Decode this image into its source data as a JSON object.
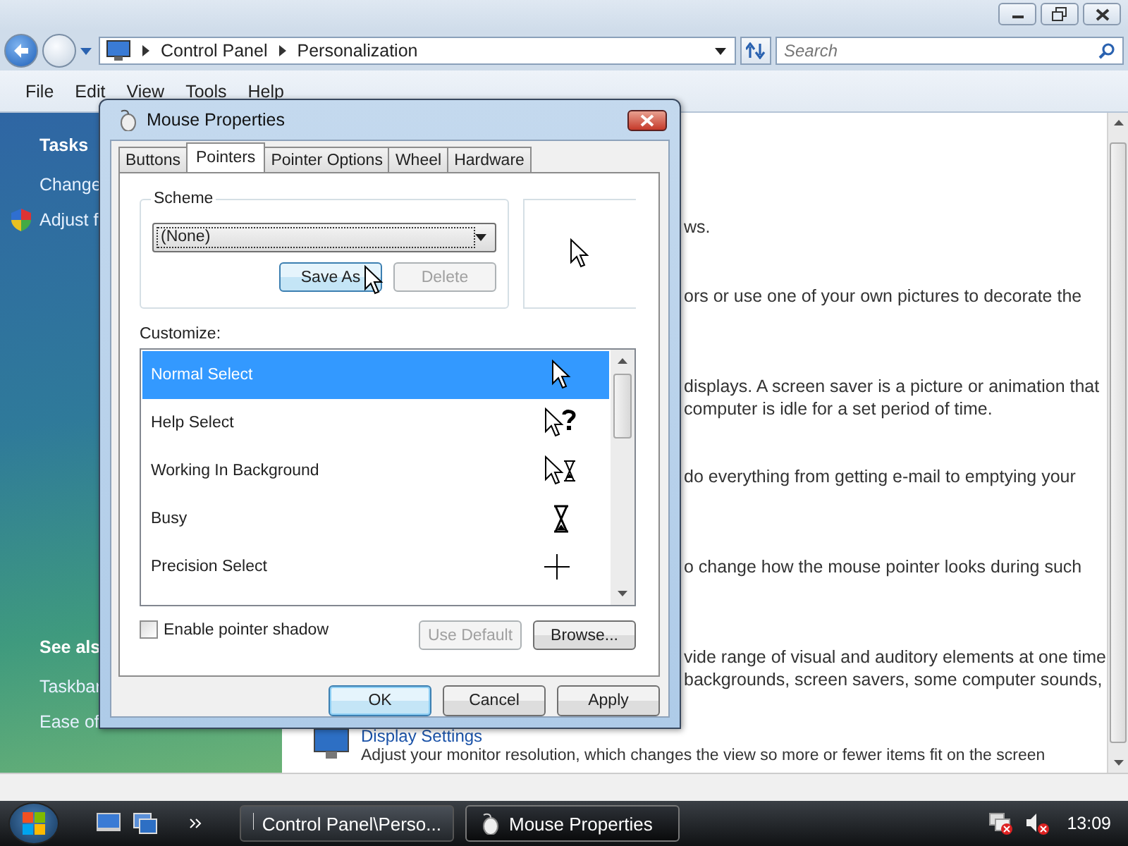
{
  "explorer": {
    "breadcrumb": [
      "Control Panel",
      "Personalization"
    ],
    "search": {
      "placeholder": "Search"
    }
  },
  "menu": [
    "File",
    "Edit",
    "View",
    "Tools",
    "Help"
  ],
  "sidebar": {
    "tasks_heading": "Tasks",
    "tasks": [
      {
        "label": "Change",
        "shield": false
      },
      {
        "label": "Adjust f",
        "shield": true
      }
    ],
    "see_also_heading": "See als",
    "see_also": [
      "Taskbar",
      "Ease of"
    ]
  },
  "content": {
    "blocks": [
      {
        "lines": [
          "ws."
        ]
      },
      {
        "lines": [
          "ors or use one of your own pictures to decorate the"
        ]
      },
      {
        "lines": [
          "displays. A screen saver is a picture or animation that",
          "computer is idle for a set period of time."
        ]
      },
      {
        "lines": [
          "do everything from getting e-mail to emptying your"
        ]
      },
      {
        "lines": [
          "o change how the mouse pointer looks during such"
        ]
      },
      {
        "lines": [
          "vide range of visual and auditory elements at one time",
          "backgrounds, screen savers, some computer sounds,"
        ]
      }
    ],
    "display_settings": {
      "title": "Display Settings",
      "description": "Adjust your monitor resolution, which changes the view so more or fewer items fit on the screen"
    }
  },
  "dialog": {
    "title": "Mouse Properties",
    "tabs": [
      {
        "label": "Buttons",
        "selected": false
      },
      {
        "label": "Pointers",
        "selected": true
      },
      {
        "label": "Pointer Options",
        "selected": false
      },
      {
        "label": "Wheel",
        "selected": false
      },
      {
        "label": "Hardware",
        "selected": false
      }
    ],
    "scheme": {
      "legend": "Scheme",
      "value": "(None)",
      "buttons": [
        {
          "label": "Save As",
          "disabled": false
        },
        {
          "label": "Delete",
          "disabled": true
        }
      ]
    },
    "customize_label": "Customize:",
    "pointers": [
      {
        "label": "Normal Select",
        "kind": "arrow",
        "selected": true
      },
      {
        "label": "Help Select",
        "kind": "help",
        "selected": false
      },
      {
        "label": "Working In Background",
        "kind": "working",
        "selected": false
      },
      {
        "label": "Busy",
        "kind": "busy",
        "selected": false
      },
      {
        "label": "Precision Select",
        "kind": "cross",
        "selected": false
      }
    ],
    "shadow": {
      "label": "Enable pointer shadow",
      "checked": false
    },
    "list_buttons": [
      {
        "label": "Use Default",
        "disabled": true
      },
      {
        "label": "Browse...",
        "disabled": false
      }
    ],
    "buttons": [
      {
        "label": "OK",
        "default": true
      },
      {
        "label": "Cancel",
        "default": false
      },
      {
        "label": "Apply",
        "default": false
      }
    ]
  },
  "taskbar": {
    "tasks": [
      {
        "label": "Control Panel\\Perso...",
        "kind": "control-panel",
        "selected": false
      },
      {
        "label": "Mouse Properties",
        "kind": "mouse",
        "selected": true
      }
    ],
    "clock": "13:09"
  }
}
